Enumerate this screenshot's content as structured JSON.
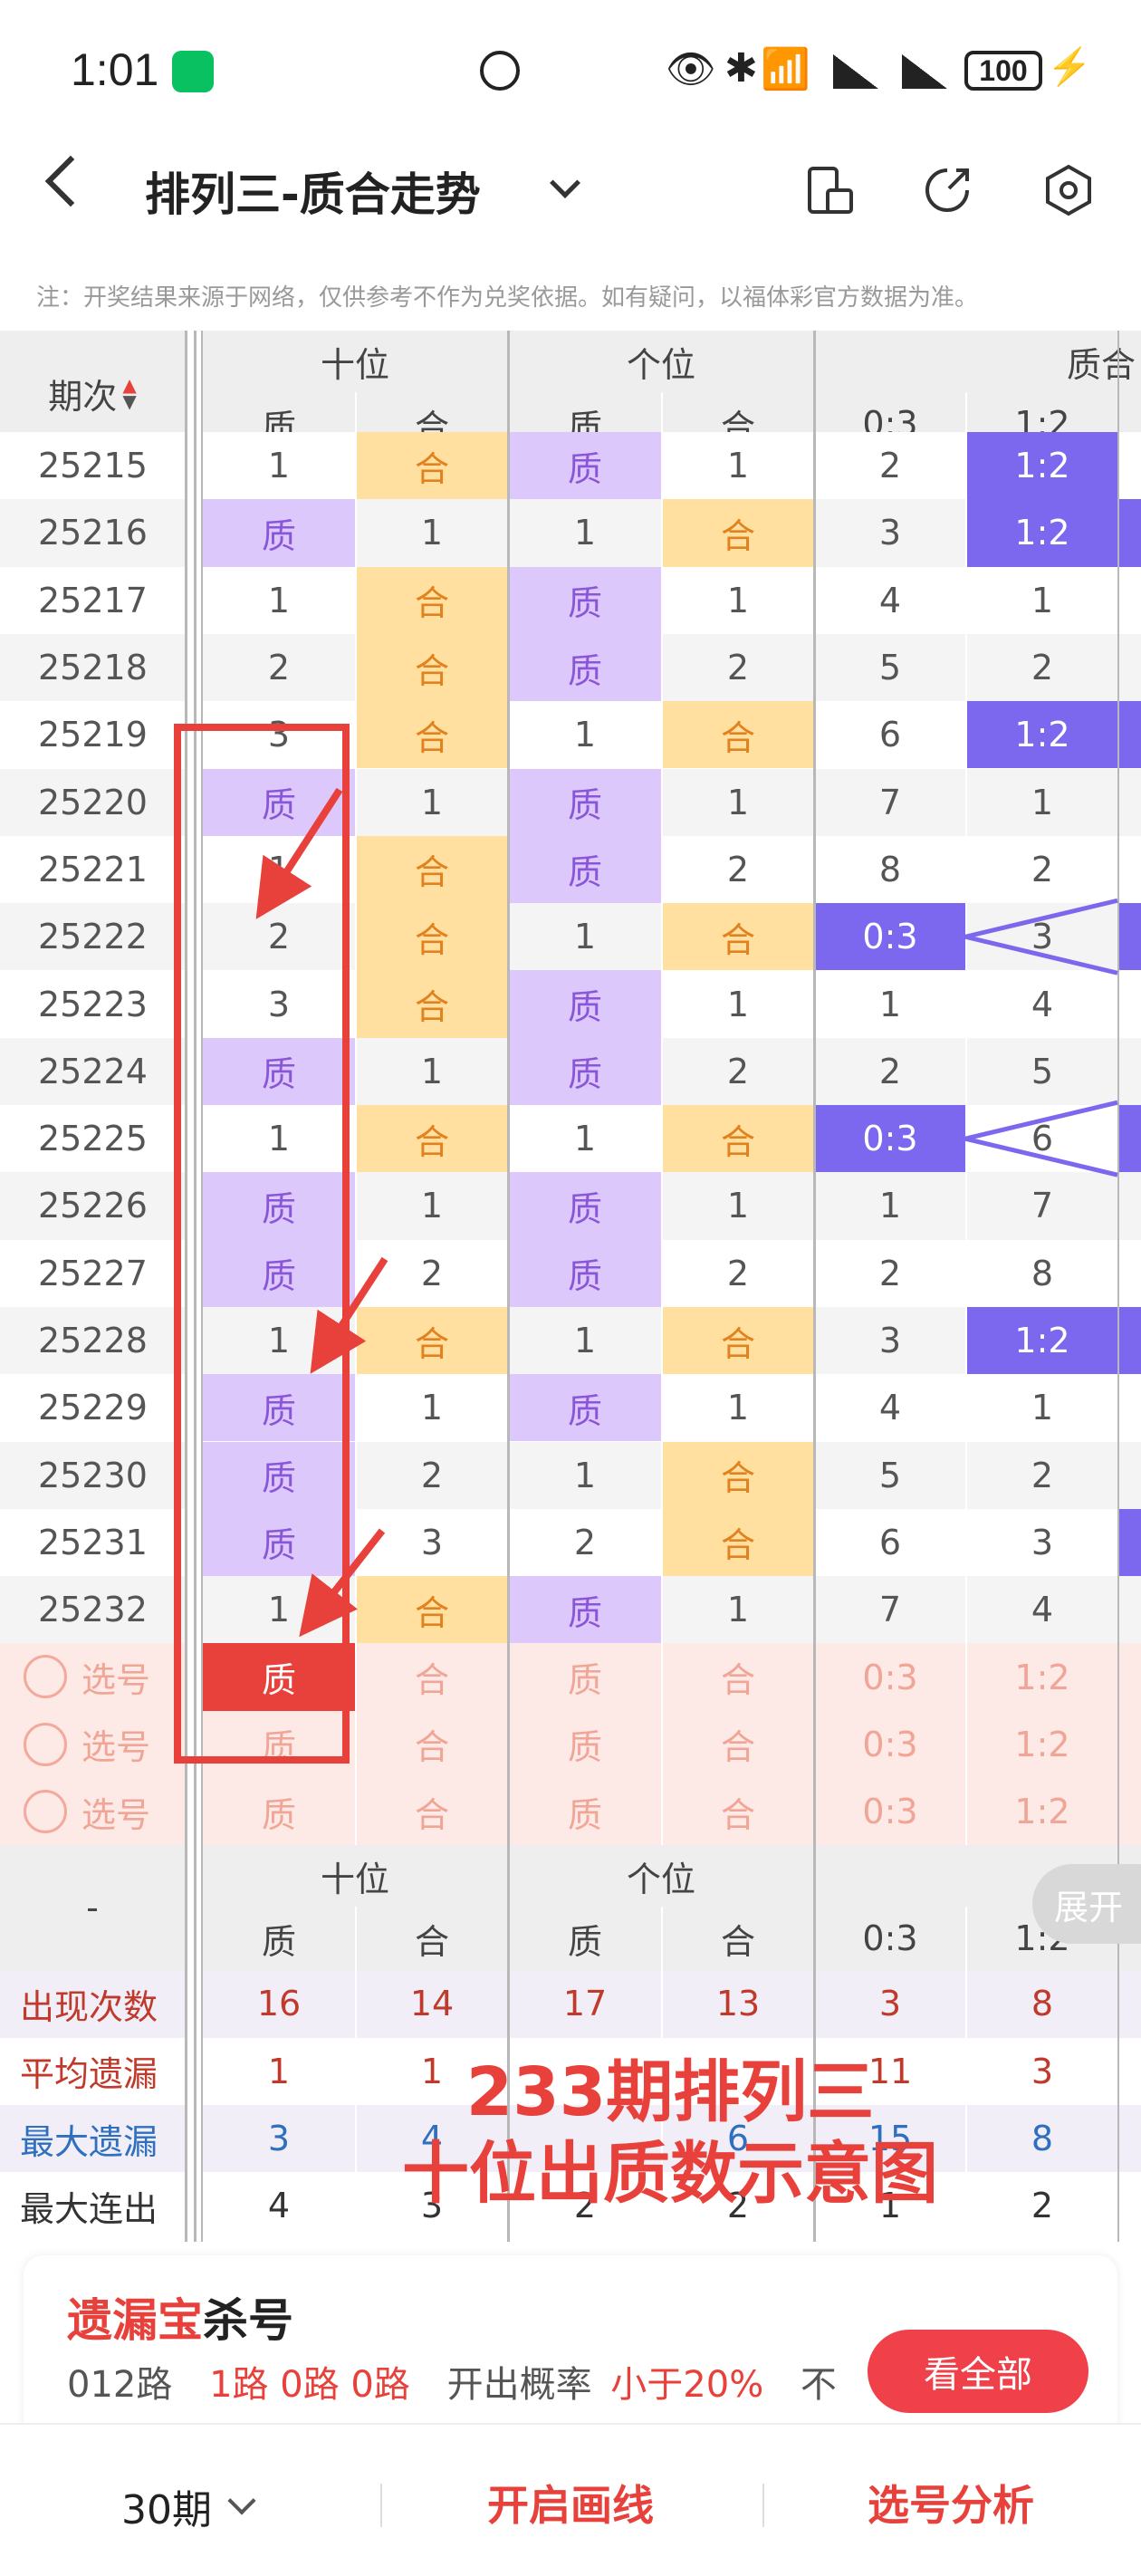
{
  "status_bar": {
    "time": "1:01",
    "battery": "100"
  },
  "header": {
    "title": "排列三-质合走势"
  },
  "note": "注：开奖结果来源于网络，仅供参考不作为兑奖依据。如有疑问，以福体彩官方数据为准。",
  "table": {
    "period_header": "期次",
    "group_headers": [
      "十位",
      "个位",
      "质合"
    ],
    "sub_headers": [
      "质",
      "合",
      "质",
      "合",
      "0:3",
      "1:2"
    ],
    "rows": [
      {
        "period": "25215",
        "cells": [
          "1",
          "合",
          "质",
          "1",
          "2",
          "1:2"
        ]
      },
      {
        "period": "25216",
        "cells": [
          "质",
          "1",
          "1",
          "合",
          "3",
          "1:2"
        ]
      },
      {
        "period": "25217",
        "cells": [
          "1",
          "合",
          "质",
          "1",
          "4",
          "1"
        ]
      },
      {
        "period": "25218",
        "cells": [
          "2",
          "合",
          "质",
          "2",
          "5",
          "2"
        ]
      },
      {
        "period": "25219",
        "cells": [
          "3",
          "合",
          "1",
          "合",
          "6",
          "1:2"
        ]
      },
      {
        "period": "25220",
        "cells": [
          "质",
          "1",
          "质",
          "1",
          "7",
          "1"
        ]
      },
      {
        "period": "25221",
        "cells": [
          "1",
          "合",
          "质",
          "2",
          "8",
          "2"
        ]
      },
      {
        "period": "25222",
        "cells": [
          "2",
          "合",
          "1",
          "合",
          "0:3",
          "3"
        ]
      },
      {
        "period": "25223",
        "cells": [
          "3",
          "合",
          "质",
          "1",
          "1",
          "4"
        ]
      },
      {
        "period": "25224",
        "cells": [
          "质",
          "1",
          "质",
          "2",
          "2",
          "5"
        ]
      },
      {
        "period": "25225",
        "cells": [
          "1",
          "合",
          "1",
          "合",
          "0:3",
          "6"
        ]
      },
      {
        "period": "25226",
        "cells": [
          "质",
          "1",
          "质",
          "1",
          "1",
          "7"
        ]
      },
      {
        "period": "25227",
        "cells": [
          "质",
          "2",
          "质",
          "2",
          "2",
          "8"
        ]
      },
      {
        "period": "25228",
        "cells": [
          "1",
          "合",
          "1",
          "合",
          "3",
          "1:2"
        ]
      },
      {
        "period": "25229",
        "cells": [
          "质",
          "1",
          "质",
          "1",
          "4",
          "1"
        ]
      },
      {
        "period": "25230",
        "cells": [
          "质",
          "2",
          "1",
          "合",
          "5",
          "2"
        ]
      },
      {
        "period": "25231",
        "cells": [
          "质",
          "3",
          "2",
          "合",
          "6",
          "3"
        ]
      },
      {
        "period": "25232",
        "cells": [
          "1",
          "合",
          "质",
          "1",
          "7",
          "4"
        ]
      }
    ],
    "pick_rows": [
      {
        "label": "选号",
        "cells": [
          "质",
          "合",
          "质",
          "合",
          "0:3",
          "1:2"
        ]
      },
      {
        "label": "选号",
        "cells": [
          "质",
          "合",
          "质",
          "合",
          "0:3",
          "1:2"
        ]
      },
      {
        "label": "选号",
        "cells": [
          "质",
          "合",
          "质",
          "合",
          "0:3",
          "1:2"
        ]
      }
    ],
    "footer_dash": "-",
    "stats": [
      {
        "label": "出现次数",
        "values": [
          "16",
          "14",
          "17",
          "13",
          "3",
          "8"
        ]
      },
      {
        "label": "平均遗漏",
        "values": [
          "1",
          "1",
          "",
          "",
          "11",
          "3"
        ]
      },
      {
        "label": "最大遗漏",
        "values": [
          "3",
          "4",
          "",
          "6",
          "15",
          "8"
        ]
      },
      {
        "label": "最大连出",
        "values": [
          "4",
          "3",
          "2",
          "2",
          "1",
          "2"
        ]
      }
    ],
    "expand_label": "展开"
  },
  "overlay_text": {
    "line1": "233期排列三",
    "line2": "十位出质数示意图"
  },
  "card": {
    "title_red": "遗漏宝",
    "title_dark": "杀号",
    "route_label": "012路",
    "routes": "1路 0路 0路",
    "prob_label": "开出概率",
    "prob_value": "小于20%",
    "trailing": "不",
    "button": "看全部"
  },
  "bottom_bar": {
    "period_select": "30期",
    "draw_line": "开启画线",
    "analysis": "选号分析"
  }
}
